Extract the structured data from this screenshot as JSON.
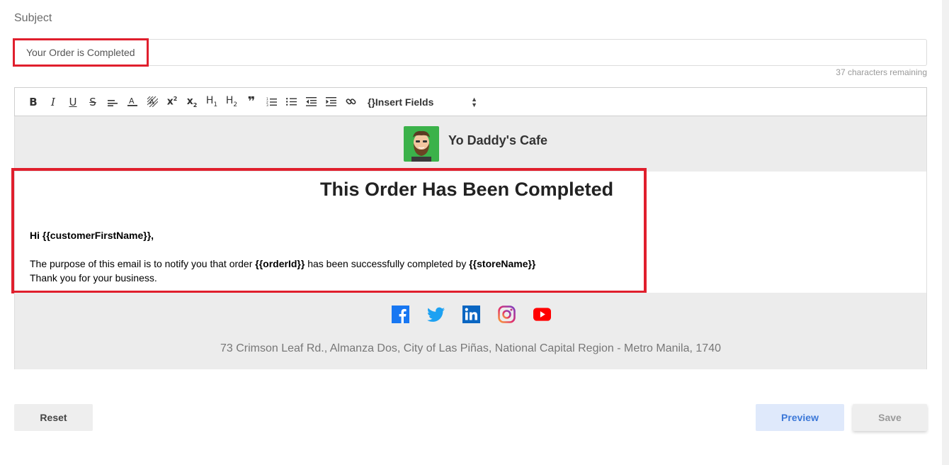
{
  "subject": {
    "label": "Subject",
    "value": "Your Order is Completed",
    "chars_remaining": "37 characters remaining"
  },
  "toolbar": {
    "buttons": [
      "bold-icon",
      "italic-icon",
      "underline-icon",
      "strikethrough-icon",
      "align-icon",
      "font-color-icon",
      "background-color-icon",
      "superscript-icon",
      "subscript-icon",
      "heading1-icon",
      "heading2-icon",
      "blockquote-icon",
      "ordered-list-icon",
      "bullet-list-icon",
      "outdent-icon",
      "indent-icon",
      "link-icon"
    ],
    "insert_fields": "{}Insert Fields"
  },
  "email": {
    "store_name": "Yo Daddy's Cafe",
    "title": "This Order Has Been Completed",
    "greeting": "Hi {{customerFirstName}},",
    "body_prefix": "The purpose of this email is to notify you that order ",
    "order_token": "{{orderId}}",
    "body_middle": " has been successfully completed by ",
    "store_token": "{{storeName}}",
    "closing": "Thank you for your business.",
    "socials": [
      "facebook-icon",
      "twitter-icon",
      "linkedin-icon",
      "instagram-icon",
      "youtube-icon"
    ],
    "address": "73 Crimson Leaf Rd., Almanza Dos, City of Las Piñas, National Capital Region - Metro Manila, 1740"
  },
  "actions": {
    "reset": "Reset",
    "preview": "Preview",
    "save": "Save"
  },
  "colors": {
    "highlight": "#e01f2d",
    "logo_bg": "#3bb24a",
    "preview_text": "#3c78d8",
    "facebook": "#1877f2",
    "twitter": "#1da1f2",
    "linkedin": "#0a66c2",
    "youtube": "#ff0000"
  }
}
